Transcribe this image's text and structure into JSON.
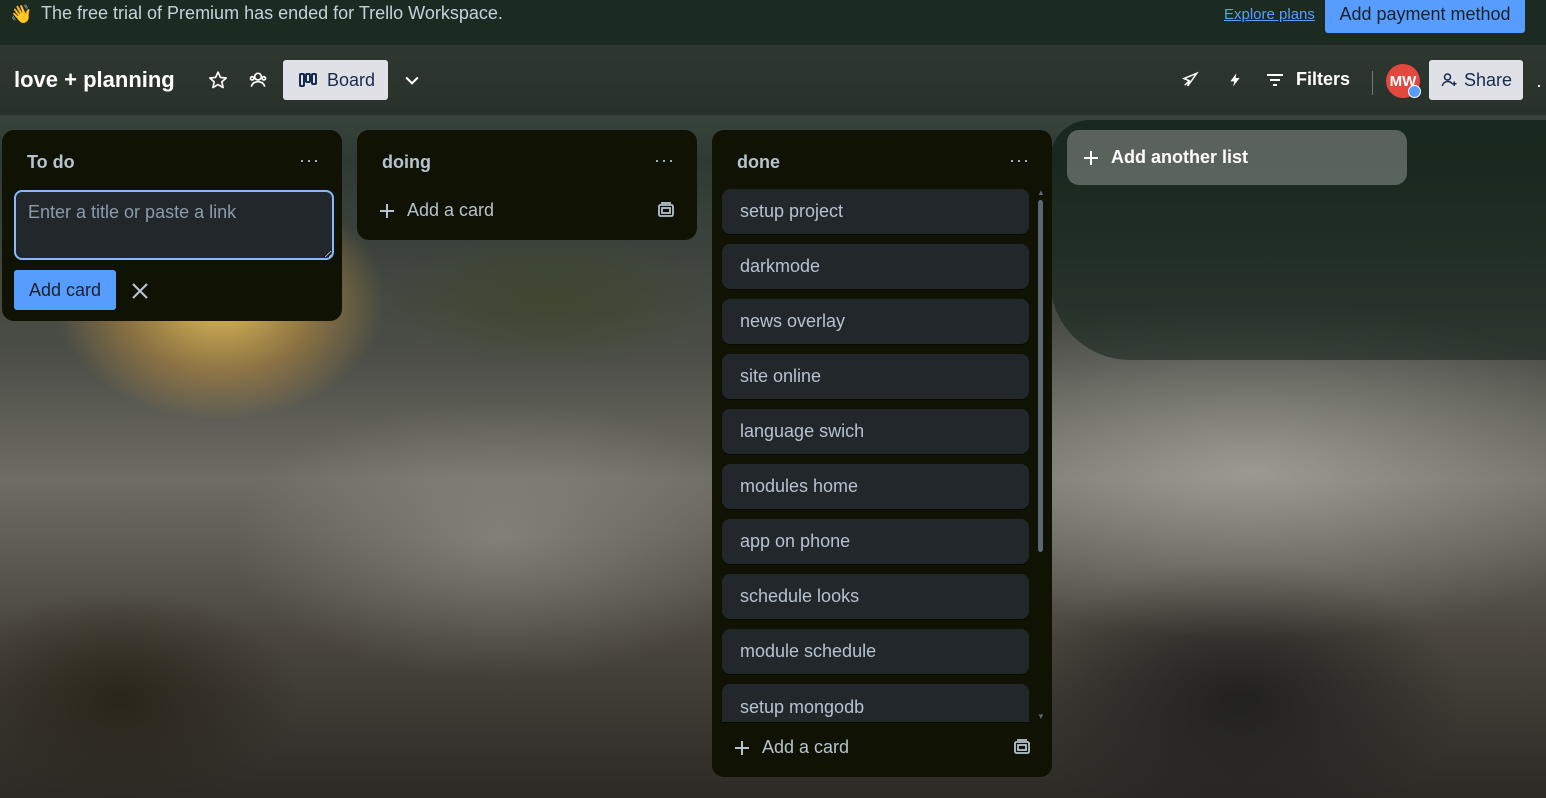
{
  "banner": {
    "emoji": "👋",
    "text": "The free trial of Premium has ended for Trello Workspace.",
    "explore_link": "Explore plans",
    "payment_button": "Add payment method"
  },
  "header": {
    "board_title": "love + planning",
    "view_label": "Board",
    "filters_label": "Filters",
    "avatar_initials": "MW",
    "share_label": "Share",
    "more": "·"
  },
  "lists": [
    {
      "title": "To do",
      "menu": "···",
      "composer": {
        "placeholder": "Enter a title or paste a link",
        "submit_label": "Add card"
      }
    },
    {
      "title": "doing",
      "menu": "···",
      "add_card_label": "Add a card"
    },
    {
      "title": "done",
      "menu": "···",
      "cards": [
        "setup project",
        "darkmode",
        "news overlay",
        "site online",
        "language swich",
        "modules home",
        "app on phone",
        "schedule looks",
        "module schedule",
        "setup mongodb"
      ],
      "add_card_label": "Add a card"
    }
  ],
  "add_list_label": "Add another list",
  "colors": {
    "banner_bg": "#1c2b22",
    "list_bg": "#101204",
    "card_bg": "#22272b",
    "accent_blue": "#579dff",
    "avatar_red": "#e2483d"
  }
}
